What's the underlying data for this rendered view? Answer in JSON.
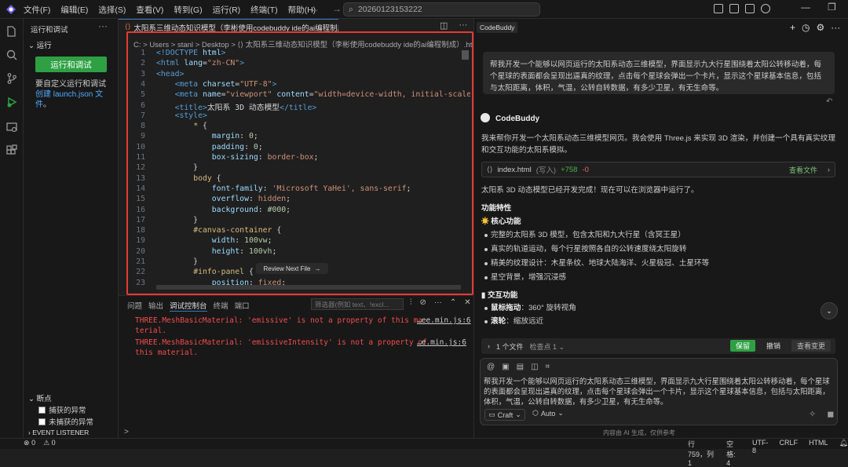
{
  "menu": [
    "文件(F)",
    "编辑(E)",
    "选择(S)",
    "查看(V)",
    "转到(G)",
    "运行(R)",
    "终端(T)",
    "帮助(H)"
  ],
  "command_center": "20260123153222",
  "sidebar": {
    "title": "运行和调试",
    "section": "运行",
    "run_button": "运行和调试",
    "hint_text": "要自定义运行和调试",
    "hint_link": "创建 launch.json 文件",
    "hint_tail": "。",
    "breakpoints_title": "断点",
    "bp_caught": "捕获的异常",
    "bp_uncaught": "未捕获的异常",
    "event_listener": "EVENT LISTENER BREAKP..."
  },
  "editor": {
    "tab_label": "太阳系三维动态知识模型（李彬使用codebuddy ide的ai编程制成）.html",
    "breadcrumb": "C: > Users > stanl > Desktop > ⟨⟩ 太阳系三维动态知识模型（李彬使用codebuddy ide的ai编程制成）.html >",
    "review_label": "Review Next File",
    "review_arrow": "→"
  },
  "panel": {
    "tabs": [
      "问题",
      "输出",
      "调试控制台",
      "终端",
      "端口"
    ],
    "active_tab": "调试控制台",
    "filter_placeholder": "筛选器(例如 text、!excl...",
    "errors": [
      {
        "line1": "THREE.MeshBasicMaterial: 'emissive' is not a property of this ma",
        "line2": "terial.",
        "link": "…ee.min.js:6"
      },
      {
        "line1": "THREE.MeshBasicMaterial: 'emissiveIntensity' is not a property of",
        "line2": "this material.",
        "link": "…e.min.js:6"
      }
    ],
    "prompt": ">"
  },
  "chat": {
    "tab": "CodeBuddy",
    "user_message": "帮我开发一个能够以网页运行的太阳系动态三维模型，界面显示九大行星围绕着太阳公转移动着，每个星球的表面都会呈现出逼真的纹理，点击每个星球会弹出一个卡片，显示这个星球基本信息，包括与太阳距离，体积，气温，公转自转数据，有多少卫星，有无生命等。",
    "bot_name": "CodeBuddy",
    "intro": "我来帮你开发一个太阳系动态三维模型网页。我会使用 Three.js 来实现 3D 渲染，并创建一个具有真实纹理和交互功能的太阳系模拟。",
    "file_name": "index.html",
    "file_write": "(写入)",
    "file_add": "+758",
    "file_del": "-0",
    "view_file": "查看文件",
    "done_text": "太阳系 3D 动态模型已经开发完成！现在可以在浏览器中运行了。",
    "features_title": "功能特性",
    "core_title": "核心功能",
    "core_items": [
      "完整的太阳系 3D 模型，包含太阳和九大行星（含冥王星）",
      "真实的轨道运动，每个行星按照各自的公转速度绕太阳旋转",
      "精美的纹理设计：木星条纹、地球大陆海洋、火星极冠、土星环等",
      "星空背景，增强沉浸感"
    ],
    "interact_title": "交互功能",
    "interact_items": [
      {
        "key": "鼠标拖动",
        "val": "：360° 旋转视角"
      },
      {
        "key": "滚轮",
        "val": "：缩放远近"
      }
    ],
    "changes_label": "1 个文件",
    "check_label": "检查点 1",
    "keep": "保留",
    "undo": "撤销",
    "view_changes": "查看变更",
    "input_text": "帮我开发一个能够以网页运行的太阳系动态三维模型，界面显示九大行星围绕着太阳公转移动着，每个星球的表面都会呈现出逼真的纹理，点击每个星球会弹出一个卡片，显示这个星球基本信息，包括与太阳距离，体积，气温，公转自转数据，有多少卫星，有无生命等。",
    "mode": "Craft",
    "model": "Auto",
    "ai_note": "内容由 AI 生成，仅供参考"
  },
  "status": {
    "errors": "0",
    "warnings": "0",
    "position": "行 759，列 1",
    "spaces": "空格: 4",
    "encoding": "UTF-8",
    "eol": "CRLF",
    "language": "HTML"
  },
  "code_lines": [
    "<!DOCTYPE html>",
    "<html lang=\"zh-CN\">",
    "<head>",
    "    <meta charset=\"UTF-8\">",
    "    <meta name=\"viewport\" content=\"width=device-width, initial-scale=1.0\">",
    "    <title>太阳系 3D 动态模型</title>",
    "    <style>",
    "        * {",
    "            margin: 0;",
    "            padding: 0;",
    "            box-sizing: border-box;",
    "        }",
    "        body {",
    "            font-family: 'Microsoft YaHei', sans-serif;",
    "            overflow: hidden;",
    "            background: #000;",
    "        }",
    "        #canvas-container {",
    "            width: 100vw;",
    "            height: 100vh;",
    "        }",
    "        #info-panel {",
    "            position: fixed;"
  ]
}
